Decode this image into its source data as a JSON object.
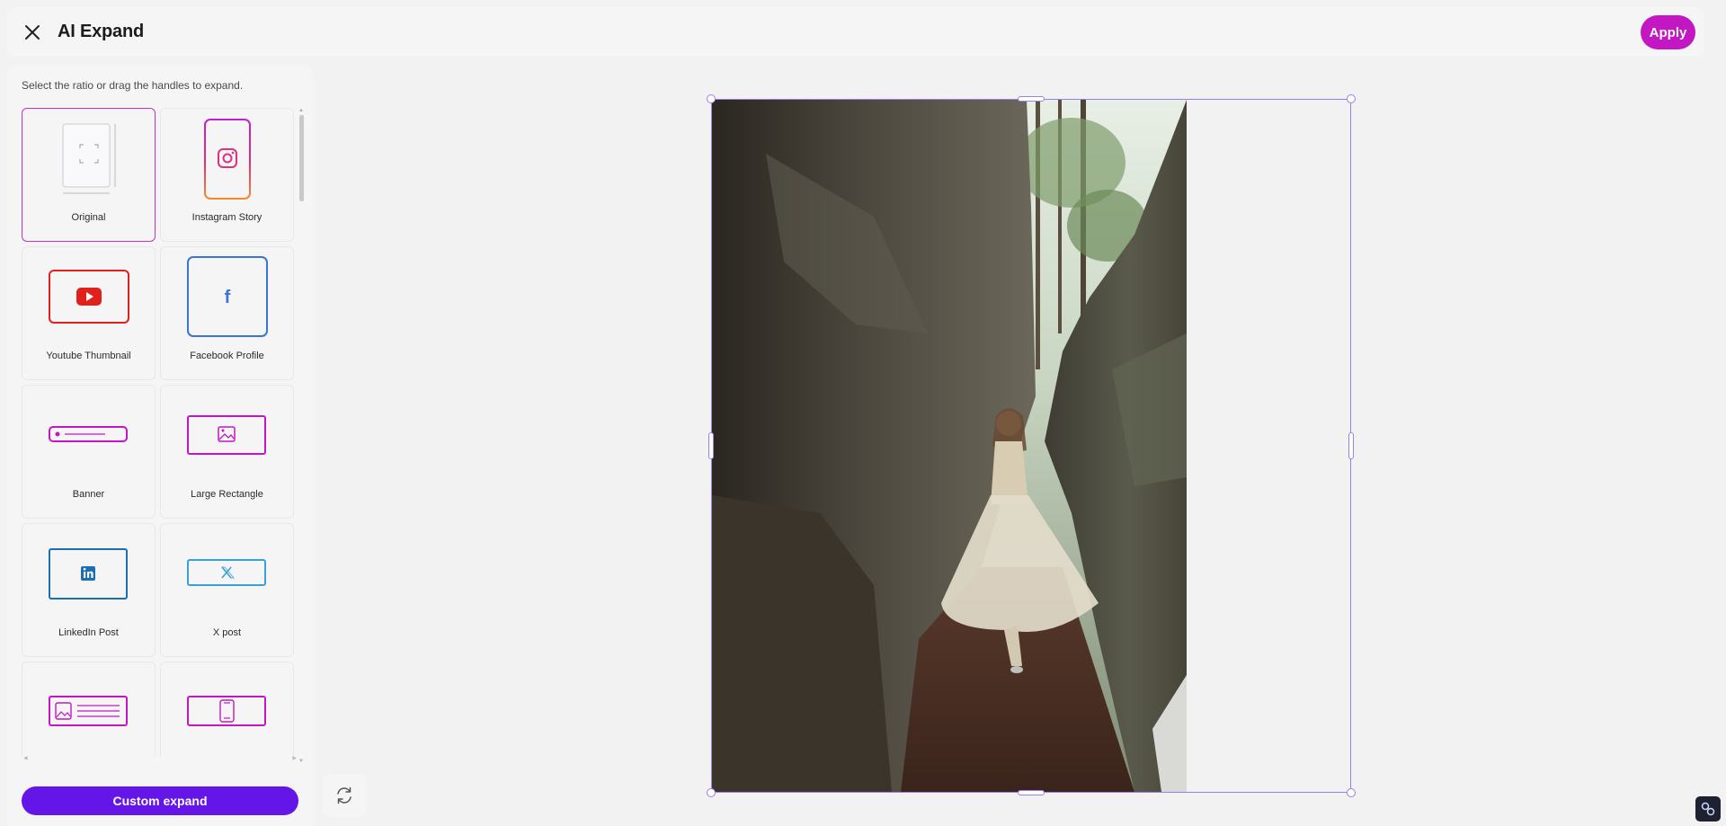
{
  "header": {
    "title": "AI Expand",
    "apply_label": "Apply",
    "close_icon": "close-icon"
  },
  "sidebar": {
    "hint": "Select the ratio or drag the handles to expand.",
    "selected": "Original",
    "presets": [
      {
        "label": "Original",
        "icon": "original-ratio-icon"
      },
      {
        "label": "Instagram Story",
        "icon": "instagram-icon"
      },
      {
        "label": "Youtube Thumbnail",
        "icon": "youtube-icon"
      },
      {
        "label": "Facebook Profile",
        "icon": "facebook-icon"
      },
      {
        "label": "Banner",
        "icon": "banner-icon"
      },
      {
        "label": "Large Rectangle",
        "icon": "large-rectangle-icon"
      },
      {
        "label": "LinkedIn Post",
        "icon": "linkedin-icon"
      },
      {
        "label": "X post",
        "icon": "x-icon"
      },
      {
        "label": "",
        "icon": "article-image-icon"
      },
      {
        "label": "",
        "icon": "mobile-icon"
      }
    ],
    "custom_expand_label": "Custom expand"
  },
  "colors": {
    "accent": "#c217c2",
    "primary_button": "#6416e8",
    "frame": "#9b7ee8",
    "youtube": "#e0201b",
    "facebook": "#3b73d6",
    "linkedin": "#1b6fb5",
    "x_post": "#3aa0d8"
  },
  "canvas": {
    "image": "photo of a woman in a flowing dress walking through a narrow rock canyon"
  }
}
